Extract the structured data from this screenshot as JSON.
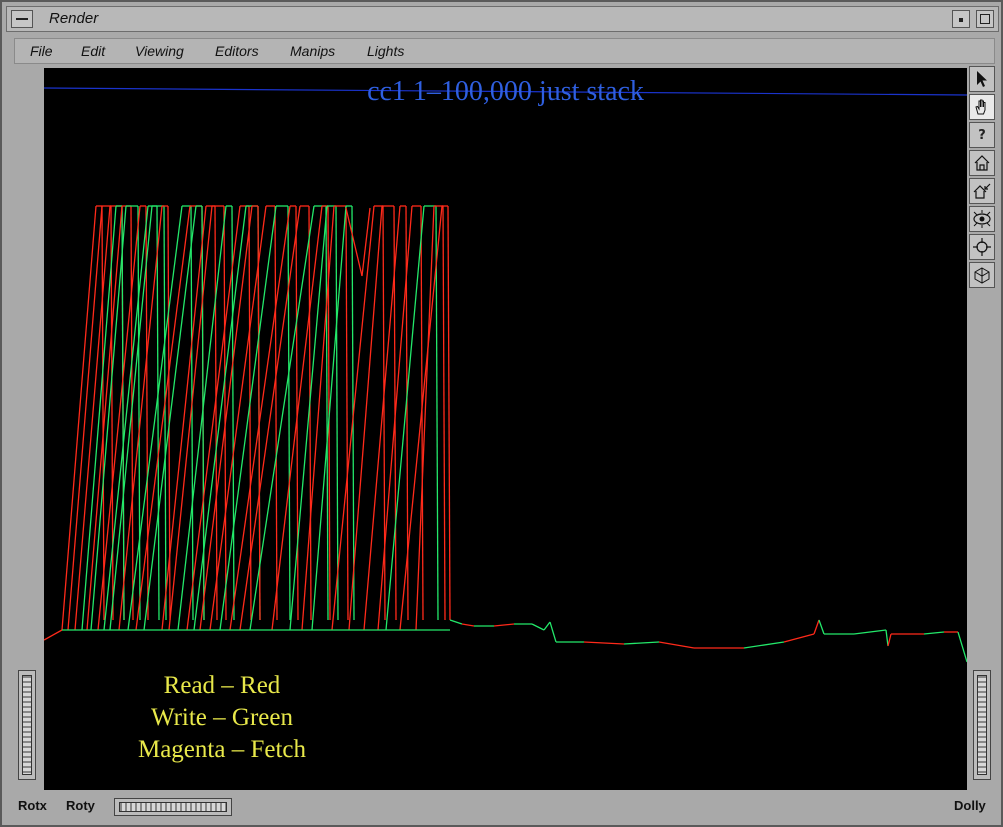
{
  "window": {
    "title": "Render"
  },
  "menu": [
    "File",
    "Edit",
    "Viewing",
    "Editors",
    "Manips",
    "Lights"
  ],
  "viewer": {
    "title": "cc1  1–100,000 just stack",
    "legend": [
      "Read – Red",
      "Write – Green",
      "Magenta – Fetch"
    ],
    "colors": {
      "read": "#ff2a1a",
      "write": "#23e86a",
      "title": "#2f5fe0",
      "legend": "#e8e84a",
      "background": "#000000",
      "guide_line": "#1a33cc"
    }
  },
  "toolbar": {
    "tools": [
      "pick-arrow-icon",
      "view-hand-icon",
      "help-icon",
      "home-icon",
      "set-home-icon",
      "view-all-icon",
      "seek-icon",
      "projection-icon"
    ],
    "help_glyph": "?"
  },
  "bottom": {
    "rotx": "Rotx",
    "roty": "Roty",
    "dolly": "Dolly"
  }
}
